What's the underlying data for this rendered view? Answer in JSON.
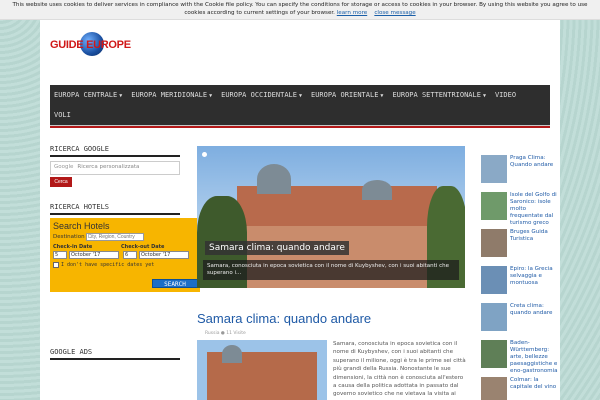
{
  "cookie": {
    "text": "This website uses cookies to deliver services in compliance with the Cookie file policy. You can specify the conditions for storage or access to cookies in your browser. By using this website you agree to use cookies according to current settings of your browser.",
    "learn_more": "learn more",
    "close": "close message"
  },
  "logo": {
    "text": "GUIDE EUROPE"
  },
  "nav": {
    "items": [
      "EUROPA CENTRALE",
      "EUROPA MERIDIONALE",
      "EUROPA OCCIDENTALE",
      "EUROPA ORIENTALE",
      "EUROPA SETTENTRIONALE",
      "VIDEO"
    ],
    "row2": [
      "VOLI"
    ]
  },
  "sidebar": {
    "google_title": "RICERCA GOOGLE",
    "google_label": "Google",
    "google_placeholder": "Ricerca personalizzata",
    "cerca": "Cerca",
    "hotels_title": "RICERCA HOTELS",
    "ads_title": "GOOGLE ADS"
  },
  "hotels": {
    "heading": "Search Hotels",
    "dest_label": "Destination",
    "dest_placeholder": "City, Region, Country",
    "checkin": "Check-in Date",
    "checkout": "Check-out Date",
    "in_day": "5",
    "in_month": "October '17",
    "out_day": "6",
    "out_month": "October '17",
    "nodates": "I don't have specific dates yet",
    "search": "SEARCH"
  },
  "hero": {
    "title": "Samara clima: quando andare",
    "excerpt": "Samara, conosciuta in epoca sovietica con il nome di Kuybyshev, con i suoi abitanti che superano i..."
  },
  "article": {
    "title": "Samara clima: quando andare",
    "meta": "Russia   ● 11 Visite",
    "excerpt": "Samara, conosciuta in epoca sovietica con il nome di Kuybyshev, con i suoi abitanti che superano il milione, oggi è tra le prime sei città più grandi della Russia. Nonostante le sue dimensioni, la città non è conosciuta all'estero a causa della politica adottata in passato dal governo sovietico che ne vietava la visita ai"
  },
  "right": [
    "Praga Clima: Quando andare",
    "Isole del Golfo di Saronico: isole molto frequentate dal turismo greco",
    "Bruges Guida Turistica",
    "Epiro: la Grecia selvaggia e montuosa",
    "Creta clima: quando andare",
    "Baden-Württemberg: arte, bellezze paesaggistiche e eno-gastronomia",
    "Colmar: la capitale del vino"
  ]
}
